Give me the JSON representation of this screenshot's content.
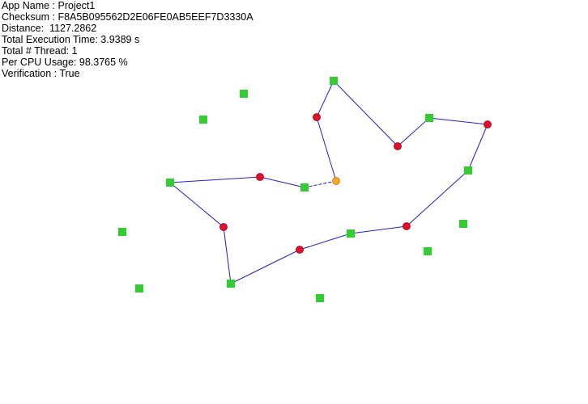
{
  "stats": {
    "app_name": "App Name : Project1",
    "checksum": "Checksum : F8A5B095562D2E06FE0AB5EEF7D3330A",
    "distance": "Distance:  1127.2862",
    "execution_time": "Total Execution Time: 3.9389 s",
    "threads": "Total # Thread: 1",
    "cpu_usage": "Per CPU Usage: 98.3765 %",
    "verification": "Verification : True"
  },
  "colors": {
    "background": "#ffffff",
    "route_line": "#2020d0",
    "route_point": "#e0102a",
    "waypoint": "#33cc33",
    "start_point": "#f5a623"
  }
}
